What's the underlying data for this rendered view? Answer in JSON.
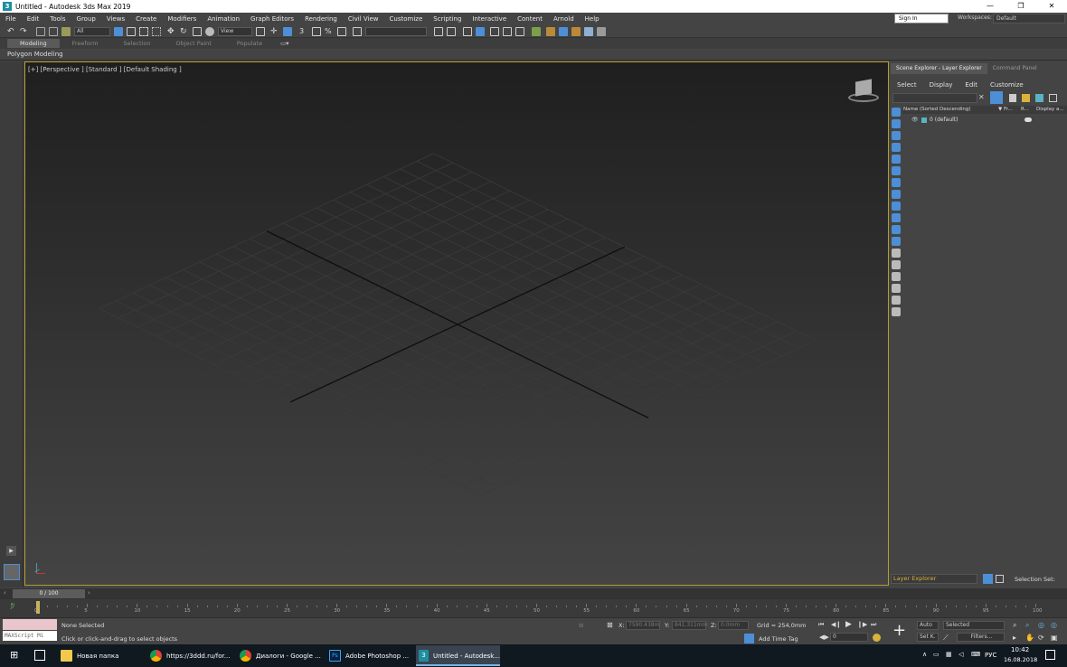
{
  "window": {
    "title": "Untitled - Autodesk 3ds Max 2019",
    "icon_letter": "3",
    "controls": [
      "—",
      "❐",
      "✕"
    ]
  },
  "menu": [
    "File",
    "Edit",
    "Tools",
    "Group",
    "Views",
    "Create",
    "Modifiers",
    "Animation",
    "Graph Editors",
    "Rendering",
    "Civil View",
    "Customize",
    "Scripting",
    "Interactive",
    "Content",
    "Arnold",
    "Help"
  ],
  "account": {
    "signin": "Sign In",
    "workspaces_label": "Workspaces:",
    "workspace": "Default"
  },
  "toolbar": {
    "filter": "All",
    "view": "View"
  },
  "ribbon": {
    "tabs": [
      "Modeling",
      "Freeform",
      "Selection",
      "Object Paint",
      "Populate"
    ],
    "sub": "Polygon Modeling"
  },
  "viewport": {
    "label": "[+] [Perspective ] [Standard ] [Default Shading ]"
  },
  "scene_explorer": {
    "tabs": [
      "Scene Explorer - Layer Explorer",
      "Command Panel"
    ],
    "menu": [
      "Select",
      "Display",
      "Edit",
      "Customize"
    ],
    "columns": [
      "Name (Sorted Descending)",
      "▼ Fr...",
      "R...",
      "Display a..."
    ],
    "row": "0 (default)",
    "bottom_select": "Layer Explorer",
    "selection_set": "Selection Set:"
  },
  "timeline": {
    "range": "0 / 100",
    "ticks": [
      0,
      5,
      10,
      15,
      20,
      25,
      30,
      35,
      40,
      45,
      50,
      55,
      60,
      65,
      70,
      75,
      80,
      85,
      90,
      95,
      100
    ]
  },
  "status": {
    "maxscript": "MAXScript Mi",
    "none_selected": "None Selected",
    "prompt": "Click or click-and-drag to select objects",
    "x_label": "X:",
    "x_value": "7590.438m",
    "y_label": "Y:",
    "y_value": "841.311mm",
    "z_label": "Z:",
    "z_value": "0.0mm",
    "grid": "Grid = 254,0mm",
    "add_time_tag": "Add Time Tag",
    "frame": "0",
    "auto": "Auto",
    "selected": "Selected",
    "set_k": "Set K.",
    "filters": "Filters..."
  },
  "taskbar": {
    "items": [
      "Новая папка",
      "https://3ddd.ru/for...",
      "Диалоги - Google ...",
      "Adobe Photoshop ...",
      "Untitled - Autodesk..."
    ],
    "lang": "РУС",
    "time": "10:42",
    "date": "16.08.2018"
  }
}
